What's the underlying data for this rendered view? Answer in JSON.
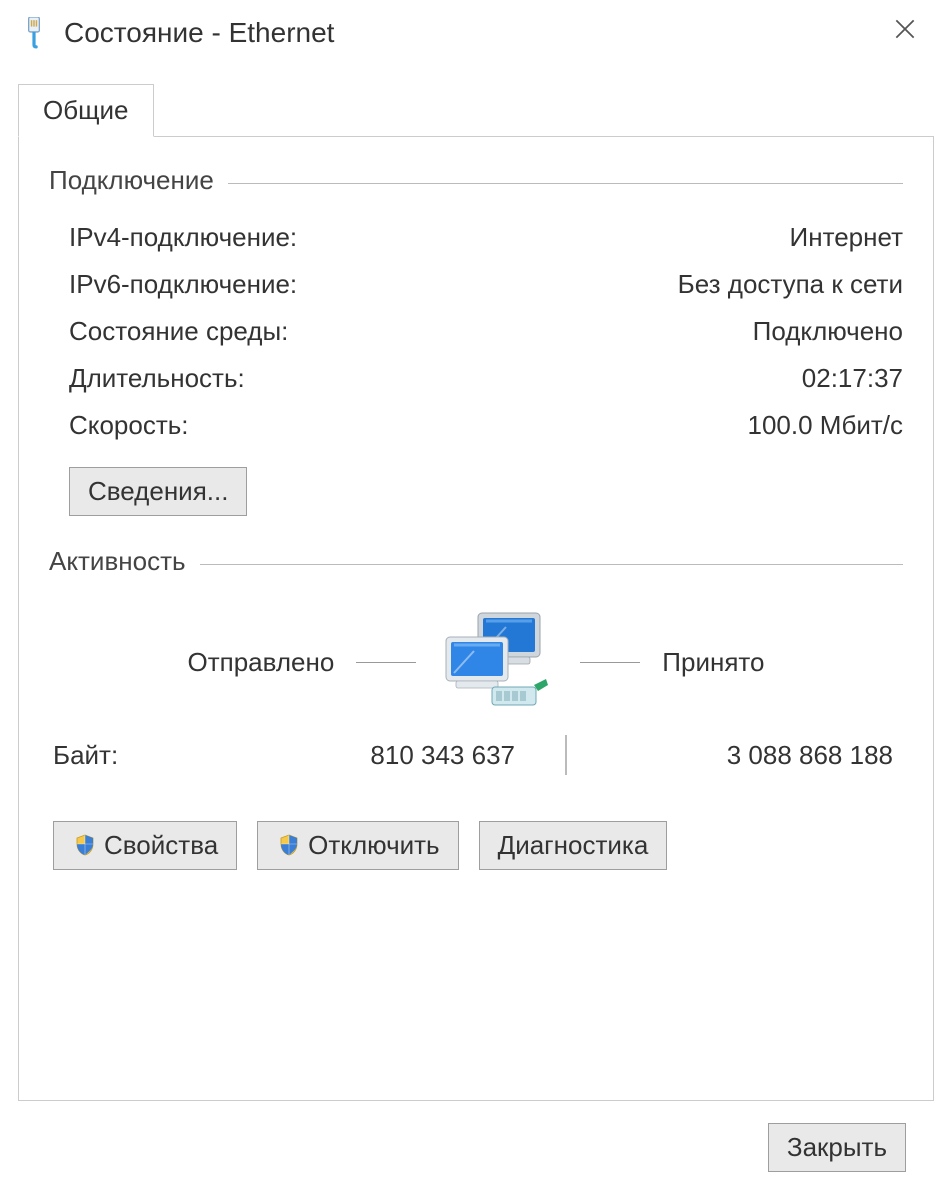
{
  "window": {
    "title": "Состояние - Ethernet"
  },
  "tabs": {
    "general": "Общие"
  },
  "connection": {
    "group_label": "Подключение",
    "ipv4_label": "IPv4-подключение:",
    "ipv4_value": "Интернет",
    "ipv6_label": "IPv6-подключение:",
    "ipv6_value": "Без доступа к сети",
    "media_label": "Состояние среды:",
    "media_value": "Подключено",
    "duration_label": "Длительность:",
    "duration_value": "02:17:37",
    "speed_label": "Скорость:",
    "speed_value": "100.0 Мбит/с",
    "details_button": "Сведения..."
  },
  "activity": {
    "group_label": "Активность",
    "sent_label": "Отправлено",
    "received_label": "Принято",
    "bytes_label": "Байт:",
    "bytes_sent": "810 343 637",
    "bytes_received": "3 088 868 188"
  },
  "buttons": {
    "properties": "Свойства",
    "disable": "Отключить",
    "diagnose": "Диагностика",
    "close": "Закрыть"
  }
}
